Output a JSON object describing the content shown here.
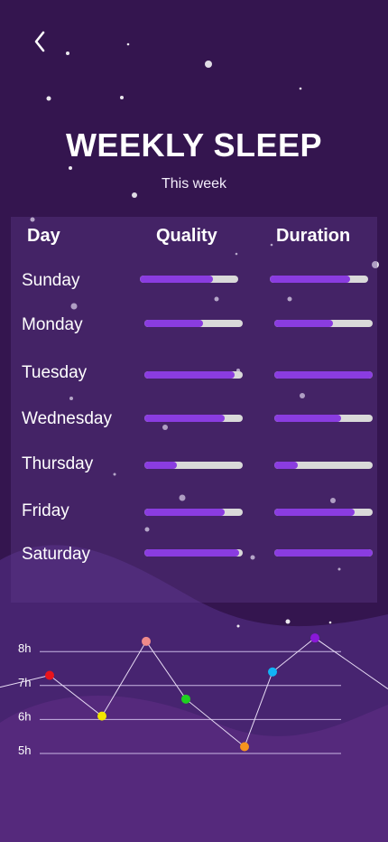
{
  "header": {
    "title": "WEEKLY SLEEP",
    "subtitle": "This week"
  },
  "table": {
    "columns": [
      "Day",
      "Quality",
      "Duration"
    ],
    "rows": [
      {
        "day": "Sunday",
        "quality": 0.74,
        "duration": 0.82
      },
      {
        "day": "Monday",
        "quality": 0.6,
        "duration": 0.6
      },
      {
        "day": "Tuesday",
        "quality": 0.92,
        "duration": 1.0
      },
      {
        "day": "Wednesday",
        "quality": 0.82,
        "duration": 0.68
      },
      {
        "day": "Thursday",
        "quality": 0.33,
        "duration": 0.24
      },
      {
        "day": "Friday",
        "quality": 0.82,
        "duration": 0.82
      },
      {
        "day": "Saturday",
        "quality": 0.96,
        "duration": 1.0
      }
    ]
  },
  "chart_data": {
    "type": "line",
    "y_tick_labels": [
      "8h",
      "7h",
      "6h",
      "5h"
    ],
    "points": [
      {
        "y": 7.3,
        "color": "#e8141c"
      },
      {
        "y": 6.1,
        "color": "#f2e600"
      },
      {
        "y": 8.3,
        "color": "#f08a8a"
      },
      {
        "y": 6.6,
        "color": "#1fd11f"
      },
      {
        "y": 5.2,
        "color": "#f7941d"
      },
      {
        "y": 7.4,
        "color": "#12b4f5"
      },
      {
        "y": 8.4,
        "color": "#8a18d8"
      }
    ]
  },
  "colors": {
    "background": "#34154f",
    "bar_fill": "#8a3ce0",
    "bar_track": "#d9d9d9"
  }
}
